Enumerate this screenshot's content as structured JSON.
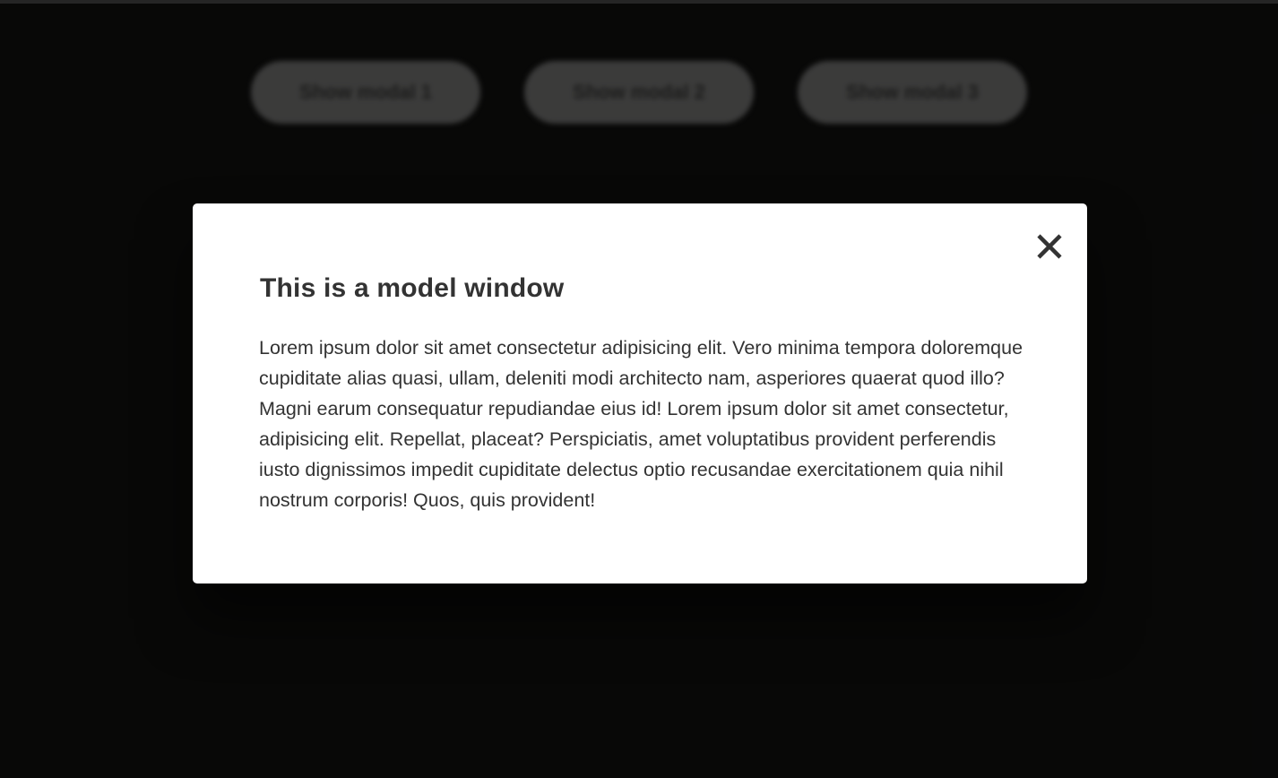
{
  "page": {
    "buttons": [
      {
        "label": "Show modal 1"
      },
      {
        "label": "Show modal 2"
      },
      {
        "label": "Show modal 3"
      }
    ]
  },
  "modal": {
    "title": "This is a model window",
    "body": "Lorem ipsum dolor sit amet consectetur adipisicing elit. Vero minima tempora doloremque cupiditate alias quasi, ullam, deleniti modi architecto nam, asperiores quaerat quod illo? Magni earum consequatur repudiandae eius id! Lorem ipsum dolor sit amet consectetur, adipisicing elit. Repellat, placeat? Perspiciatis, amet voluptatibus provident perferendis iusto dignissimos impedit cupiditate delectus optio recusandae exercitationem quia nihil nostrum corporis! Quos, quis provident!",
    "close_icon": "close-icon"
  },
  "colors": {
    "page_background": "#0d0d0c",
    "modal_background": "#ffffff",
    "text": "#333333",
    "button_background": "#5b5b5a"
  }
}
